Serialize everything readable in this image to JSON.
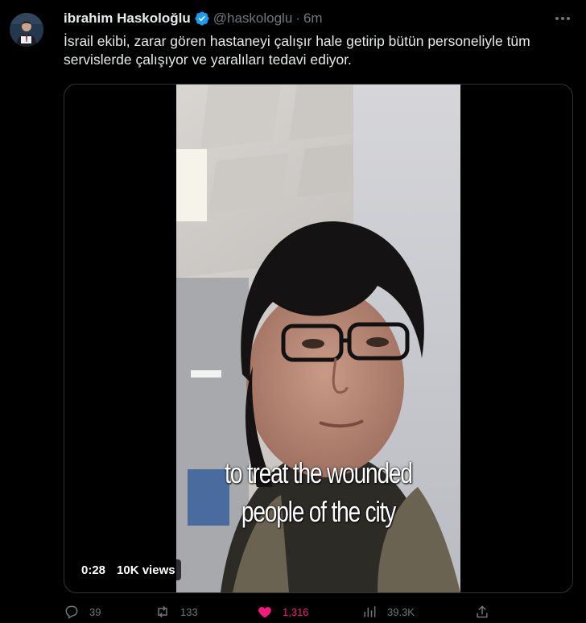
{
  "author": {
    "display_name": "ibrahim Haskoloğlu",
    "handle": "@haskologlu",
    "separator": "·",
    "time": "6m"
  },
  "tweet": {
    "text": "İsrail ekibi, zarar gören hastaneyi çalışır hale getirip bütün personeliyle tüm servislerde çalışıyor ve yaralıları tedavi ediyor."
  },
  "video": {
    "caption_line1": "to treat the wounded",
    "caption_line2": "people of the city",
    "duration": "0:28",
    "views": "10K views"
  },
  "actions": {
    "replies": "39",
    "reposts": "133",
    "likes": "1,316",
    "views": "39.3K"
  },
  "colors": {
    "background": "#000000",
    "verified": "#1d9bf0",
    "like": "#f91880",
    "muted": "#71767b"
  }
}
